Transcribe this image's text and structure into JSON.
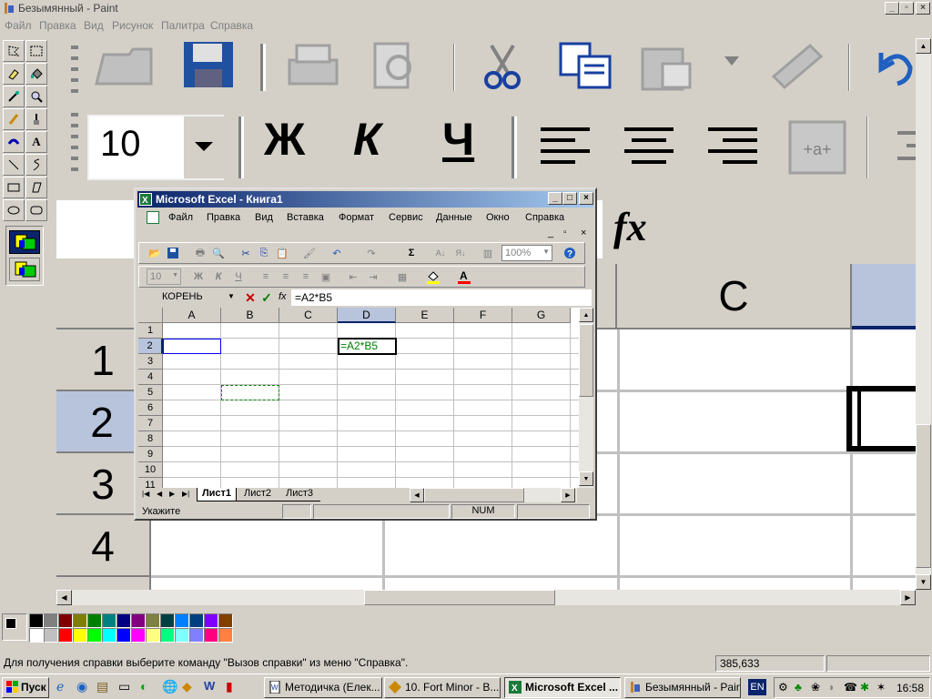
{
  "paint": {
    "title": "Безымянный - Paint",
    "menu": [
      "Файл",
      "Правка",
      "Вид",
      "Рисунок",
      "Палитра",
      "Справка"
    ],
    "font_size_value": "10",
    "bold_glyph": "Ж",
    "italic_glyph": "К",
    "underline_glyph": "Ч",
    "fx_glyph": "fx",
    "big_col_c": "C",
    "big_rows": [
      "1",
      "2",
      "3",
      "4"
    ],
    "status_help": "Для получения справки выберите команду \"Вызов справки\" из меню \"Справка\".",
    "status_coords": "385,633",
    "colors": [
      "#000000",
      "#808080",
      "#800000",
      "#808000",
      "#008000",
      "#008080",
      "#000080",
      "#800080",
      "#808040",
      "#004040",
      "#0080ff",
      "#004080",
      "#8000ff",
      "#804000",
      "#ffffff",
      "#c0c0c0",
      "#ff0000",
      "#ffff00",
      "#00ff00",
      "#00ffff",
      "#0000ff",
      "#ff00ff",
      "#ffff80",
      "#00ff80",
      "#80ffff",
      "#8080ff",
      "#ff0080",
      "#ff8040"
    ]
  },
  "excel": {
    "title": "Microsoft Excel - Книга1",
    "menu": [
      "Файл",
      "Правка",
      "Вид",
      "Вставка",
      "Формат",
      "Сервис",
      "Данные",
      "Окно",
      "Справка"
    ],
    "zoom": "100%",
    "font_size": "10",
    "bold": "Ж",
    "italic": "К",
    "underline": "Ч",
    "name_box": "КОРЕНЬ",
    "fx_label": "fx",
    "formula": "=A2*B5",
    "columns": [
      "A",
      "B",
      "C",
      "D",
      "E",
      "F",
      "G"
    ],
    "rows": [
      "1",
      "2",
      "3",
      "4",
      "5",
      "6",
      "7",
      "8",
      "9",
      "10",
      "11"
    ],
    "cell_d2": "=A2*B5",
    "sheets": [
      "Лист1",
      "Лист2",
      "Лист3"
    ],
    "status_mode": "Укажите",
    "status_num": "NUM"
  },
  "taskbar": {
    "start": "Пуск",
    "tasks": [
      "Методичка (Елек...",
      "10. Fort Minor - В...",
      "Microsoft Excel ...",
      "Безымянный - Paint"
    ],
    "lang": "EN",
    "clock": "16:58"
  }
}
